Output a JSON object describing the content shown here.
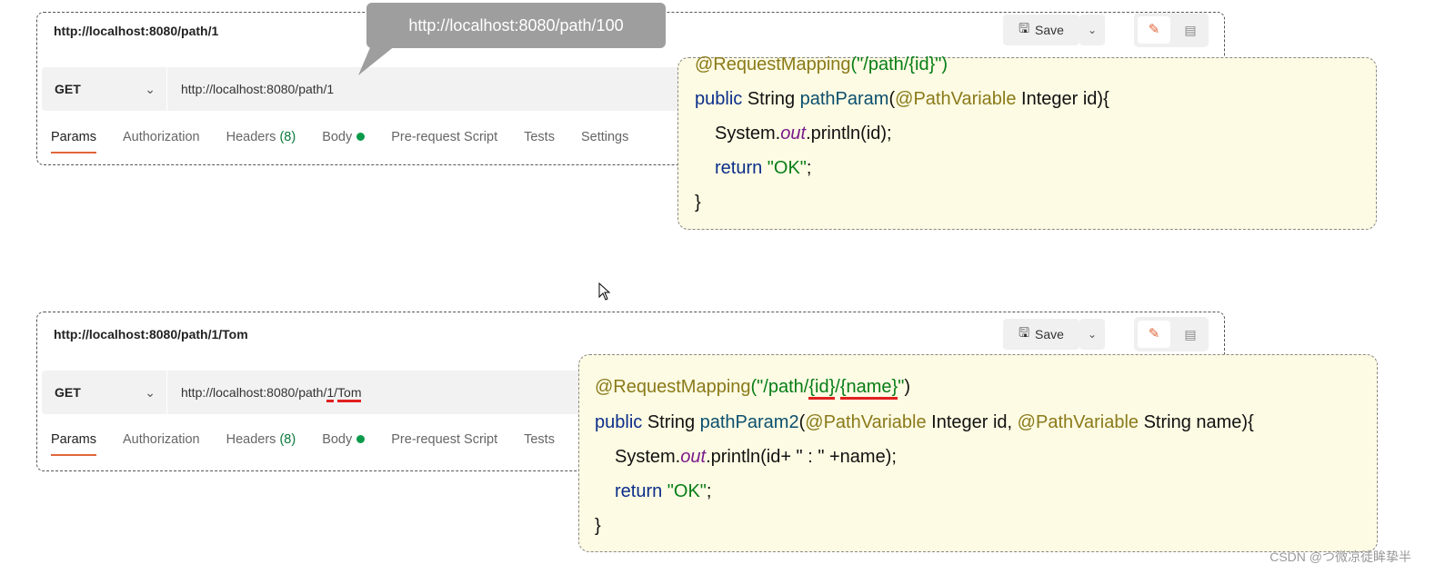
{
  "request1": {
    "title": "http://localhost:8080/path/1",
    "method": "GET",
    "url": "http://localhost:8080/path/1",
    "save": "Save",
    "tabs": [
      "Params",
      "Authorization",
      "Headers",
      "Body",
      "Pre-request Script",
      "Tests",
      "Settings"
    ],
    "headers_count": "(8)"
  },
  "tooltip": "http://localhost:8080/path/100",
  "request2": {
    "title": "http://localhost:8080/path/1/Tom",
    "method": "GET",
    "url_prefix": "http://localhost:8080/path/",
    "url_id": "1",
    "url_sep": "/",
    "url_name": "Tom",
    "save": "Save",
    "tabs": [
      "Params",
      "Authorization",
      "Headers",
      "Body",
      "Pre-request Script",
      "Tests"
    ],
    "headers_count": "(8)"
  },
  "code1": {
    "annotation": "@RequestMapping",
    "ann_args": "(\"/path/{id}\")",
    "kw_public": "public",
    "type_string": " String ",
    "method": "pathParam",
    "paren": "(",
    "pv": "@PathVariable",
    "param": " Integer id){",
    "sys": "System.",
    "out": "out",
    "println": ".println(id);",
    "kw_return": "return",
    "ret_val": " \"OK\"",
    "semi": ";",
    "close": "}"
  },
  "code2": {
    "annotation": "@RequestMapping",
    "q1": "(\"/path/",
    "id": "{id}",
    "slash": "/",
    "name": "{name}",
    "q2": "\"",
    "close_paren": ")",
    "kw_public": "public",
    "type_string": " String ",
    "method": "pathParam2",
    "paren": "(",
    "pv": "@PathVariable",
    "param1": " Integer id, ",
    "param2": " String name){",
    "sys": "System.",
    "out": "out",
    "println": ".println(id+ \" : \" +name);",
    "kw_return": "return",
    "ret_val": " \"OK\"",
    "semi": ";",
    "close": "}"
  },
  "watermark": "CSDN @つ微凉徒眸挚半"
}
